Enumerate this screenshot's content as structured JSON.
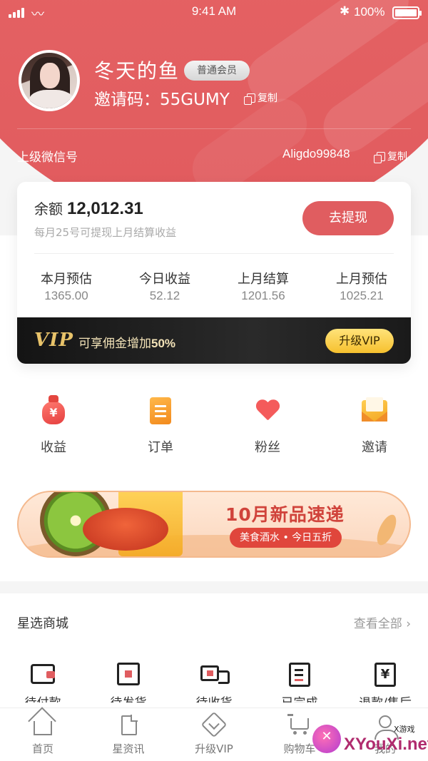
{
  "status_bar": {
    "time": "9:41 AM",
    "battery": "100%"
  },
  "profile": {
    "username": "冬天的鱼",
    "member_badge": "普通会员",
    "invite_code": "邀请码：55GUMY",
    "copy_label": "复制"
  },
  "superior": {
    "label": "上级微信号",
    "id": "Aligdo99848",
    "copy_label": "复制"
  },
  "balance": {
    "label": "余额",
    "value": "12,012.31",
    "note": "每月25号可提现上月结算收益",
    "withdraw_button": "去提现"
  },
  "stats": [
    {
      "label": "本月预估",
      "value": "1365.00"
    },
    {
      "label": "今日收益",
      "value": "52.12"
    },
    {
      "label": "上月结算",
      "value": "1201.56"
    },
    {
      "label": "上月预估",
      "value": "1025.21"
    }
  ],
  "vip": {
    "logo": "VIP",
    "text_prefix": "可享佣金增加",
    "text_rate": "50%",
    "button": "升级VIP"
  },
  "quick_actions": [
    {
      "label": "收益",
      "icon": "money-bag-icon",
      "symbol": "¥"
    },
    {
      "label": "订单",
      "icon": "order-doc-icon"
    },
    {
      "label": "粉丝",
      "icon": "heart-icon"
    },
    {
      "label": "邀请",
      "icon": "envelope-icon"
    }
  ],
  "banner": {
    "title": "10月新品速递",
    "tag": "美食酒水 • 今日五折"
  },
  "mall": {
    "title": "星选商城",
    "more": "查看全部 ›",
    "items": [
      {
        "label": "待付款",
        "icon": "wallet-icon"
      },
      {
        "label": "待发货",
        "icon": "box-icon"
      },
      {
        "label": "待收货",
        "icon": "truck-icon"
      },
      {
        "label": "已完成",
        "icon": "checklist-icon"
      },
      {
        "label": "退款/售后",
        "icon": "refund-icon",
        "symbol": "¥"
      }
    ]
  },
  "tabbar": [
    {
      "label": "首页",
      "icon": "home-icon"
    },
    {
      "label": "星资讯",
      "icon": "document-icon"
    },
    {
      "label": "升级VIP",
      "icon": "vip-diamond-icon"
    },
    {
      "label": "购物车",
      "icon": "cart-icon"
    },
    {
      "label": "我的",
      "icon": "user-icon"
    }
  ],
  "watermark": {
    "small": "X游戏",
    "text": "XYouXi.net"
  },
  "colors": {
    "brand": "#e05d60",
    "vip_gold": "#f6c12e",
    "vip_bar": "#141414"
  }
}
